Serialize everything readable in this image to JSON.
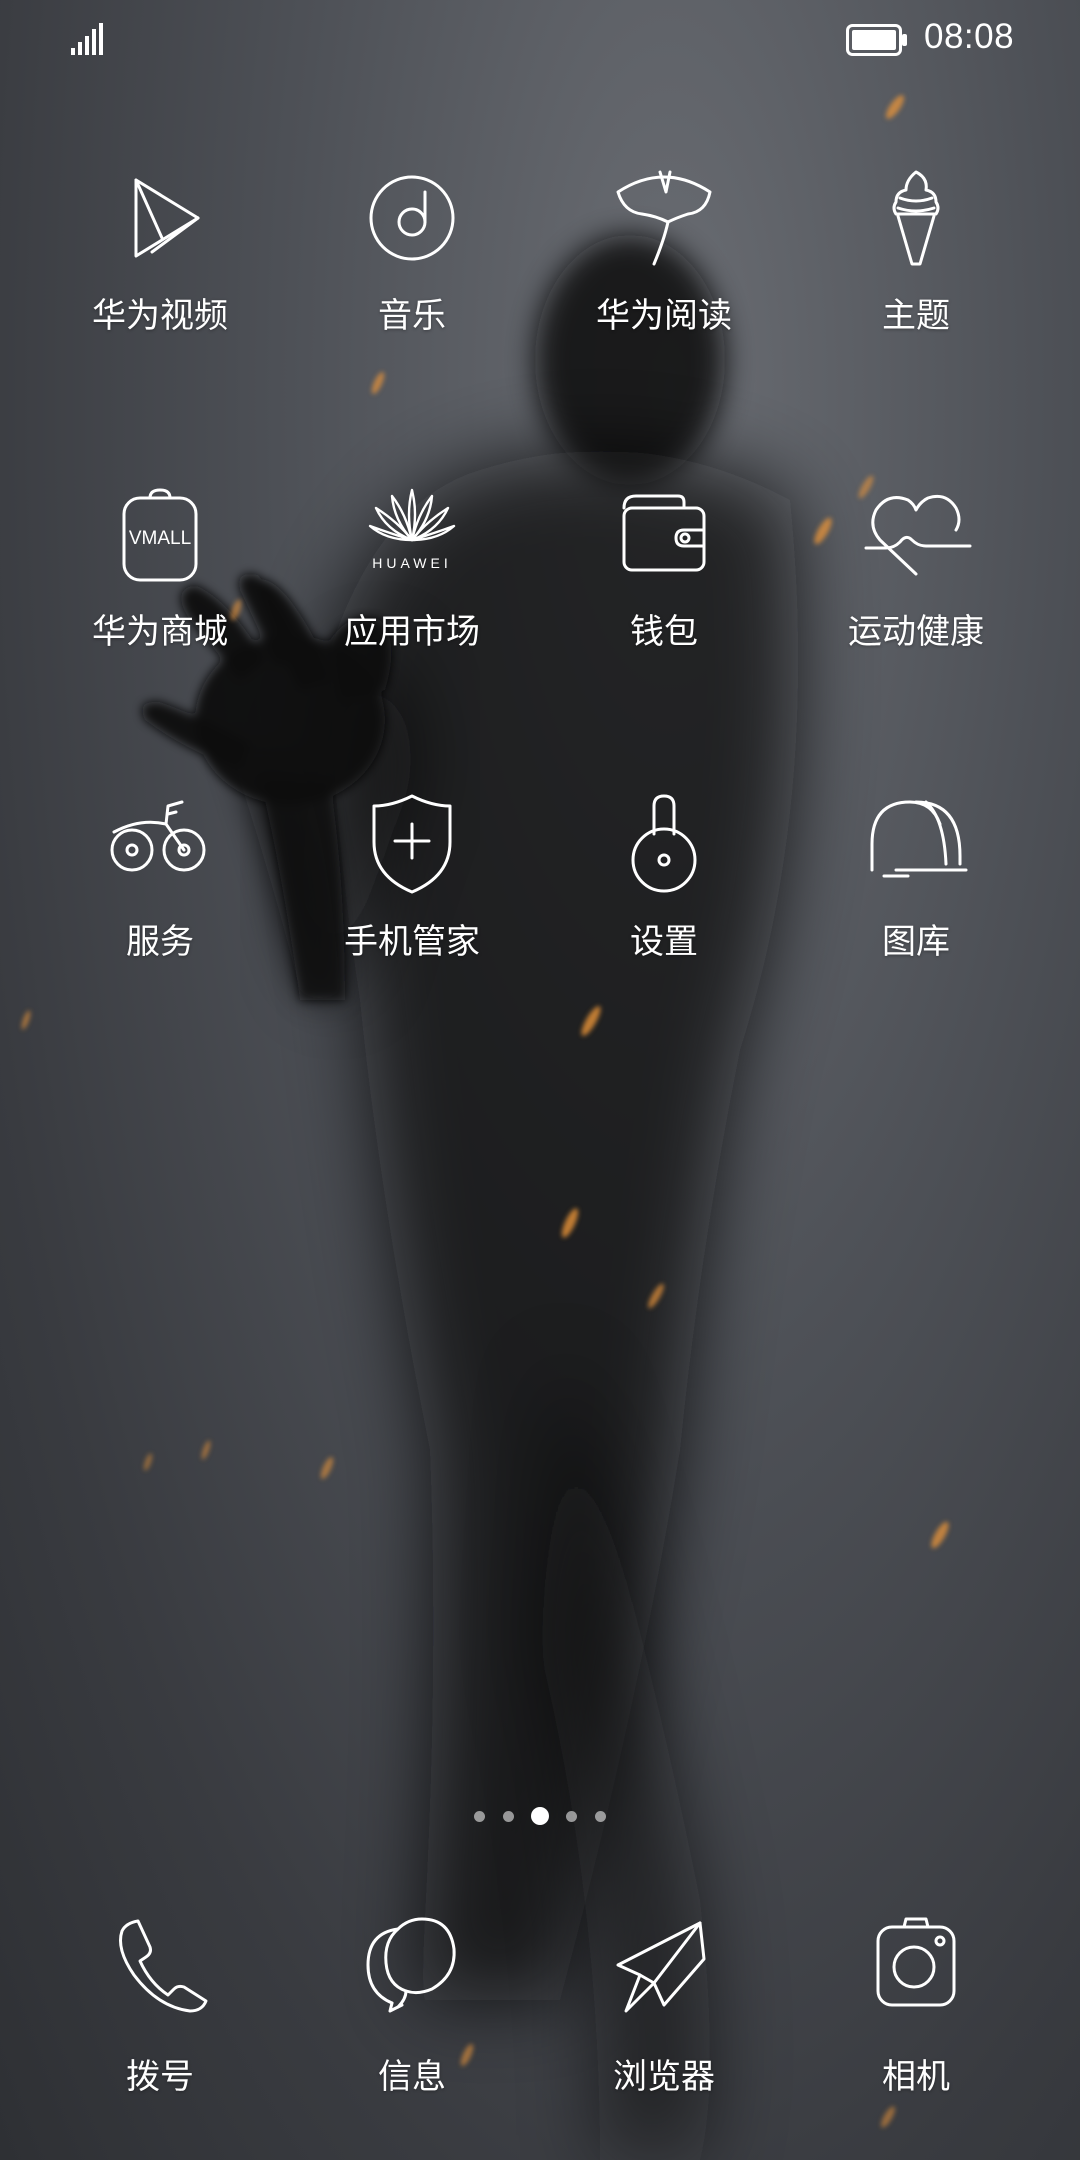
{
  "status_bar": {
    "time": "08:08",
    "signal_icon": "signal-bars-icon",
    "battery_icon": "battery-full-icon"
  },
  "apps": [
    {
      "label": "华为视频",
      "icon": "play-video-icon"
    },
    {
      "label": "音乐",
      "icon": "music-disc-icon"
    },
    {
      "label": "华为阅读",
      "icon": "ginkgo-leaf-icon"
    },
    {
      "label": "主题",
      "icon": "ice-cream-icon"
    },
    {
      "label": "华为商城",
      "icon": "vmall-bag-icon",
      "icon_text": "VMALL"
    },
    {
      "label": "应用市场",
      "icon": "huawei-logo-icon",
      "icon_text": "HUAWEI"
    },
    {
      "label": "钱包",
      "icon": "wallet-icon"
    },
    {
      "label": "运动健康",
      "icon": "heart-pulse-icon"
    },
    {
      "label": "服务",
      "icon": "bicycle-icon"
    },
    {
      "label": "手机管家",
      "icon": "shield-plus-icon"
    },
    {
      "label": "设置",
      "icon": "lock-icon"
    },
    {
      "label": "图库",
      "icon": "arches-icon"
    }
  ],
  "pages": {
    "count": 5,
    "current": 3
  },
  "dock": [
    {
      "label": "拨号",
      "icon": "phone-icon"
    },
    {
      "label": "信息",
      "icon": "message-bubble-icon"
    },
    {
      "label": "浏览器",
      "icon": "paper-plane-icon"
    },
    {
      "label": "相机",
      "icon": "camera-icon"
    }
  ],
  "colors": {
    "background": "#4a4d53",
    "icon_stroke": "#ffffff",
    "spark": "#e8943a"
  }
}
